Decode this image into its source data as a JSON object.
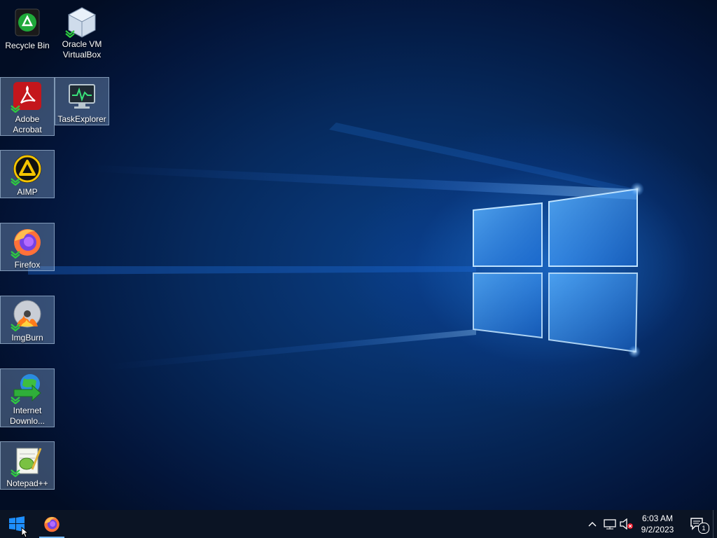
{
  "desktop": {
    "icons": [
      {
        "label": "Recycle Bin",
        "icon": "recycle-bin-icon"
      },
      {
        "label": "Oracle VM VirtualBox",
        "icon": "virtualbox-icon"
      },
      {
        "label": "Adobe Acrobat",
        "icon": "acrobat-icon"
      },
      {
        "label": "TaskExplorer",
        "icon": "task-explorer-icon"
      },
      {
        "label": "AIMP",
        "icon": "aimp-icon"
      },
      {
        "label": "Firefox",
        "icon": "firefox-icon"
      },
      {
        "label": "ImgBurn",
        "icon": "imgburn-icon"
      },
      {
        "label": "Internet Downlo...",
        "icon": "internet-download-manager-icon"
      },
      {
        "label": "Notepad++",
        "icon": "notepad-plus-plus-icon"
      }
    ]
  },
  "taskbar": {
    "start": {
      "icon": "windows-start-icon"
    },
    "pinned": [
      {
        "icon": "firefox-icon"
      }
    ],
    "tray": {
      "icons": [
        "chevron-up-icon",
        "network-icon",
        "speaker-muted-icon"
      ],
      "time": "6:03 AM",
      "date": "9/2/2023",
      "notification_count": "1"
    }
  },
  "colors": {
    "accent": "#1e8fff",
    "taskbar": "#0b1424"
  }
}
